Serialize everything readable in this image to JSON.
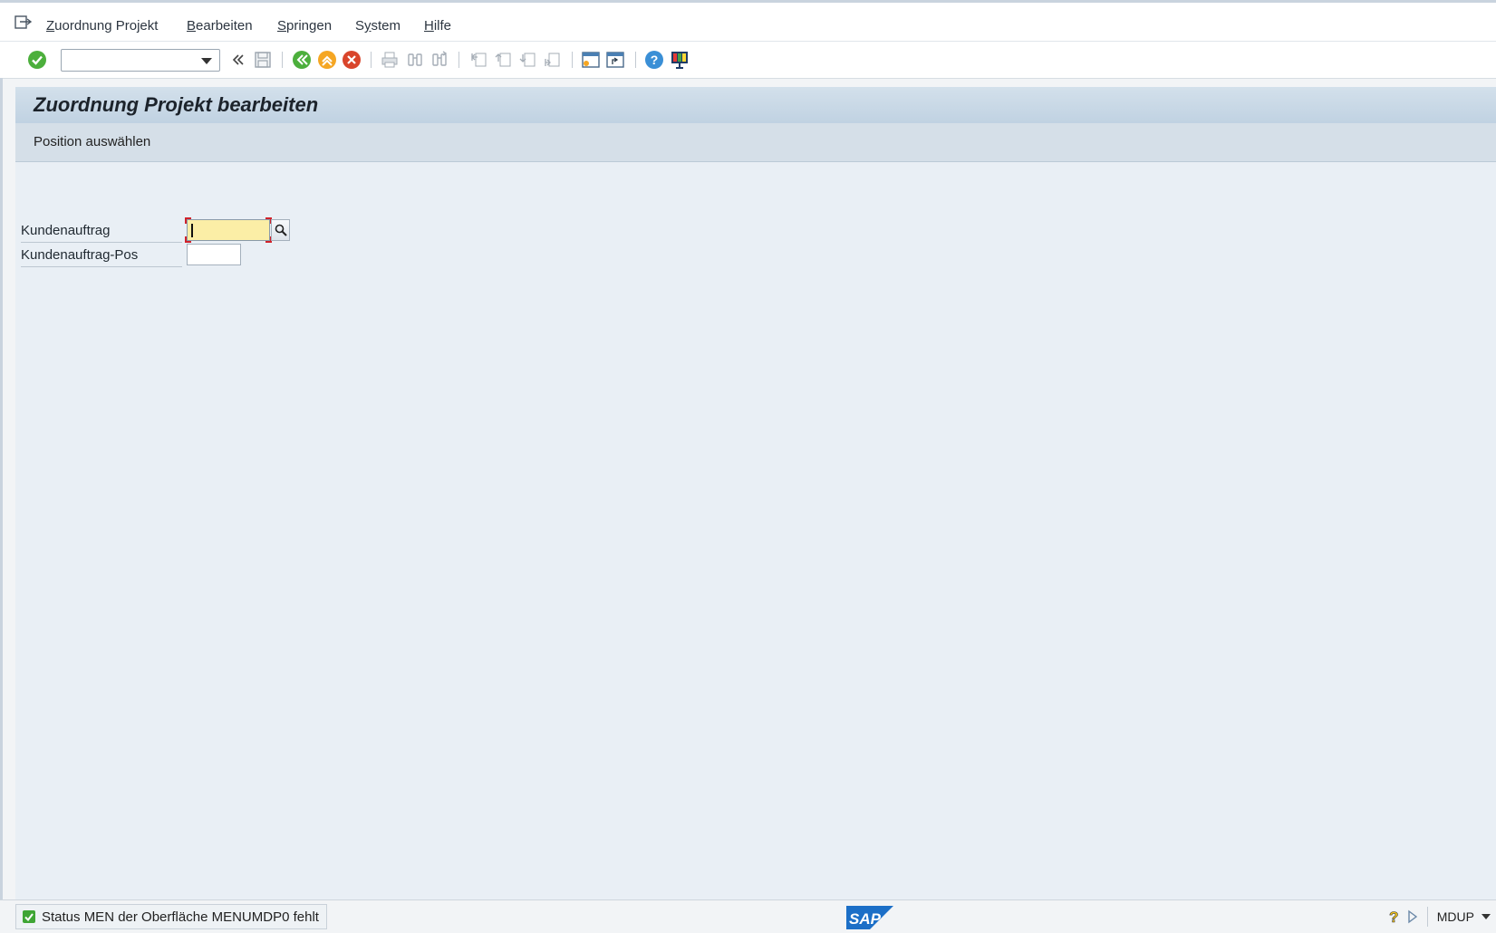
{
  "menubar": {
    "items": [
      {
        "label": "Zuordnung Projekt",
        "mnemonic": "Z"
      },
      {
        "label": "Bearbeiten",
        "mnemonic": "B"
      },
      {
        "label": "Springen",
        "mnemonic": "S"
      },
      {
        "label": "System",
        "mnemonic": "y"
      },
      {
        "label": "Hilfe",
        "mnemonic": "H"
      }
    ]
  },
  "toolbar": {
    "command_field_value": "",
    "icons": [
      "enter-icon",
      "back-icon",
      "exit-icon",
      "cancel-icon",
      "save-icon",
      "print-icon",
      "find-icon",
      "find-next-icon",
      "first-page-icon",
      "previous-page-icon",
      "next-page-icon",
      "last-page-icon",
      "create-session-icon",
      "shortcut-icon",
      "help-icon",
      "customize-layout-icon"
    ]
  },
  "screen": {
    "title": "Zuordnung Projekt bearbeiten",
    "app_toolbar": {
      "button_label": "Position auswählen"
    },
    "fields": [
      {
        "label": "Kundenauftrag",
        "value": "",
        "focused": true,
        "has_value_help": true
      },
      {
        "label": "Kundenauftrag-Pos",
        "value": "",
        "focused": false,
        "has_value_help": false
      }
    ]
  },
  "statusbar": {
    "message": "Status MEN der Oberfläche MENUMDP0 fehlt",
    "message_type": "success",
    "system": "MDUP"
  },
  "colors": {
    "title_bar": "#c0d2e2",
    "app_toolbar": "#d5dfe8",
    "screen_bg": "#e9eff5",
    "focus_field": "#fbeea6",
    "focus_marker": "#d0222b",
    "sap_blue": "#1c6fc7"
  }
}
